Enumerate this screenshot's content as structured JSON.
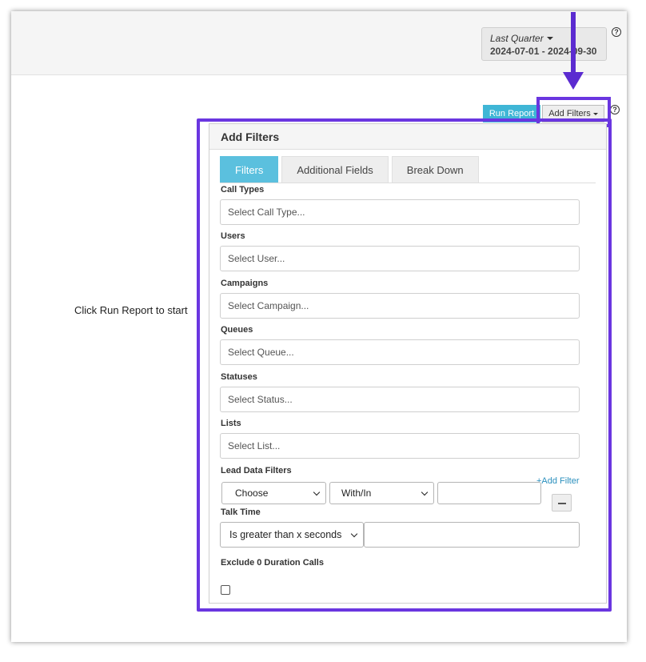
{
  "date_picker": {
    "label": "Last Quarter",
    "range": "2024-07-01 - 2024-09-30"
  },
  "help_glyph": "?",
  "toolbar": {
    "run_report": "Run Report",
    "add_filters": "Add Filters"
  },
  "main": {
    "empty_message": "Click Run Report to start"
  },
  "panel": {
    "title": "Add Filters",
    "tabs": [
      {
        "label": "Filters",
        "active": true
      },
      {
        "label": "Additional Fields",
        "active": false
      },
      {
        "label": "Break Down",
        "active": false
      }
    ],
    "fields": {
      "call_types": {
        "label": "Call Types",
        "placeholder": "Select Call Type..."
      },
      "users": {
        "label": "Users",
        "placeholder": "Select User..."
      },
      "campaigns": {
        "label": "Campaigns",
        "placeholder": "Select Campaign..."
      },
      "queues": {
        "label": "Queues",
        "placeholder": "Select Queue..."
      },
      "statuses": {
        "label": "Statuses",
        "placeholder": "Select Status..."
      },
      "lists": {
        "label": "Lists",
        "placeholder": "Select List..."
      }
    },
    "lead_data": {
      "label": "Lead Data Filters",
      "add_link": "+Add Filter",
      "field_select": "Choose",
      "operator_select": "With/In",
      "value": ""
    },
    "talk_time": {
      "label": "Talk Time",
      "operator_select": "Is greater than x seconds",
      "value": ""
    },
    "exclude_zero": {
      "label": "Exclude 0 Duration Calls",
      "checked": false
    }
  },
  "colors": {
    "accent": "#5bc0de",
    "run_button": "#3fb6d6",
    "highlight": "#6a36e0",
    "link": "#2a8fbd"
  }
}
